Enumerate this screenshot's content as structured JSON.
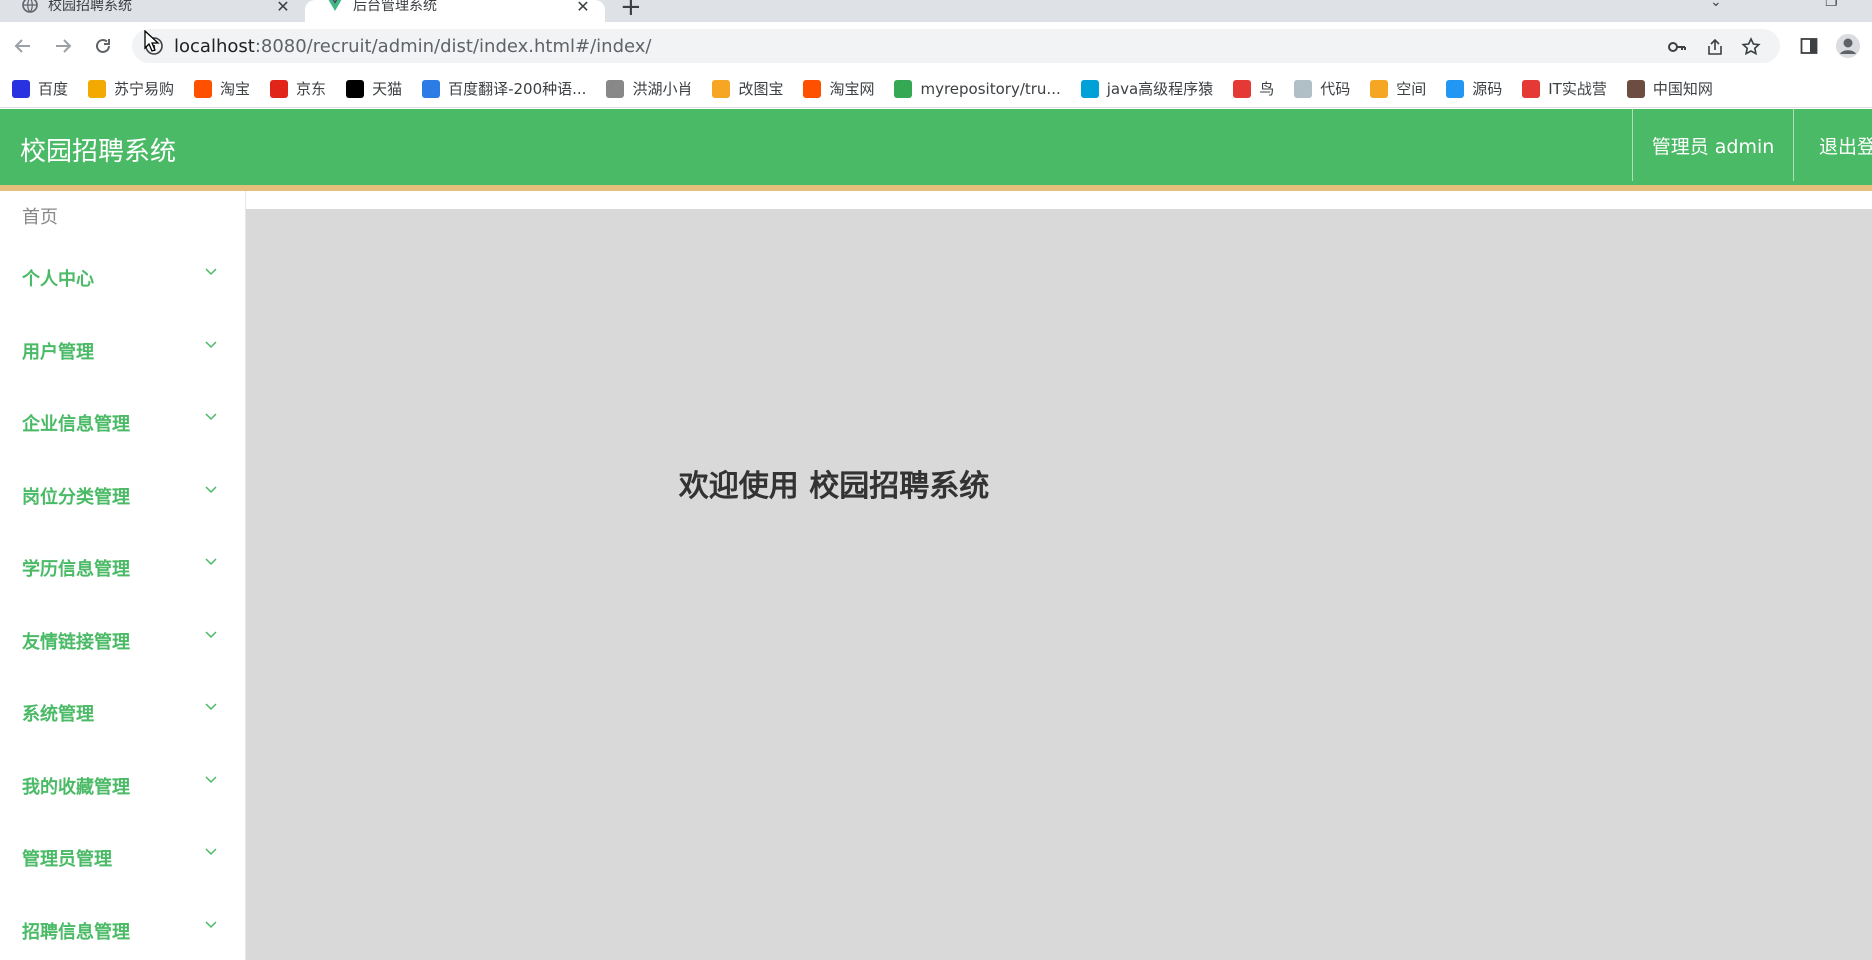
{
  "browser": {
    "tabs": [
      {
        "title": "校园招聘系统",
        "active": false
      },
      {
        "title": "后台管理系统",
        "active": true
      }
    ],
    "url_host": "localhost",
    "url_rest": ":8080/recruit/admin/dist/index.html#/index/",
    "bookmarks": [
      {
        "label": "百度",
        "icon": "baidu-icon",
        "color": "#2932e1"
      },
      {
        "label": "苏宁易购",
        "icon": "suning-icon",
        "color": "#f2a900"
      },
      {
        "label": "淘宝",
        "icon": "taobao-icon",
        "color": "#ff5000"
      },
      {
        "label": "京东",
        "icon": "jd-icon",
        "color": "#e1251b"
      },
      {
        "label": "天猫",
        "icon": "tmall-icon",
        "color": "#000000"
      },
      {
        "label": "百度翻译-200种语...",
        "icon": "translate-icon",
        "color": "#2d7be5"
      },
      {
        "label": "洪湖小肖",
        "icon": "bird-icon",
        "color": "#888888"
      },
      {
        "label": "改图宝",
        "icon": "gaitubao-icon",
        "color": "#f6a623"
      },
      {
        "label": "淘宝网",
        "icon": "taobao-icon",
        "color": "#ff5000"
      },
      {
        "label": "myrepository/tru...",
        "icon": "chrome-icon",
        "color": "#34a853"
      },
      {
        "label": "java高级程序猿",
        "icon": "bilibili-icon",
        "color": "#00a1d6"
      },
      {
        "label": "鸟",
        "icon": "bird-red-icon",
        "color": "#e53935"
      },
      {
        "label": "代码",
        "icon": "code-icon",
        "color": "#b0bec5"
      },
      {
        "label": "空间",
        "icon": "qzone-icon",
        "color": "#f5a623"
      },
      {
        "label": "源码",
        "icon": "fish-icon",
        "color": "#2196f3"
      },
      {
        "label": "IT实战营",
        "icon": "chrome-red-icon",
        "color": "#e53935"
      },
      {
        "label": "中国知网",
        "icon": "cnki-icon",
        "color": "#6d4c41"
      }
    ]
  },
  "app": {
    "title": "校园招聘系统",
    "user_label": "管理员 admin",
    "logout_label": "退出登录",
    "home_label": "首页",
    "menu": [
      {
        "label": "个人中心"
      },
      {
        "label": "用户管理"
      },
      {
        "label": "企业信息管理"
      },
      {
        "label": "岗位分类管理"
      },
      {
        "label": "学历信息管理"
      },
      {
        "label": "友情链接管理"
      },
      {
        "label": "系统管理"
      },
      {
        "label": "我的收藏管理"
      },
      {
        "label": "管理员管理"
      },
      {
        "label": "招聘信息管理"
      }
    ],
    "welcome": "欢迎使用 校园招聘系统"
  },
  "colors": {
    "brand": "#4aba66",
    "accent": "#e6c07b",
    "content_bg": "#d9d9d9"
  }
}
